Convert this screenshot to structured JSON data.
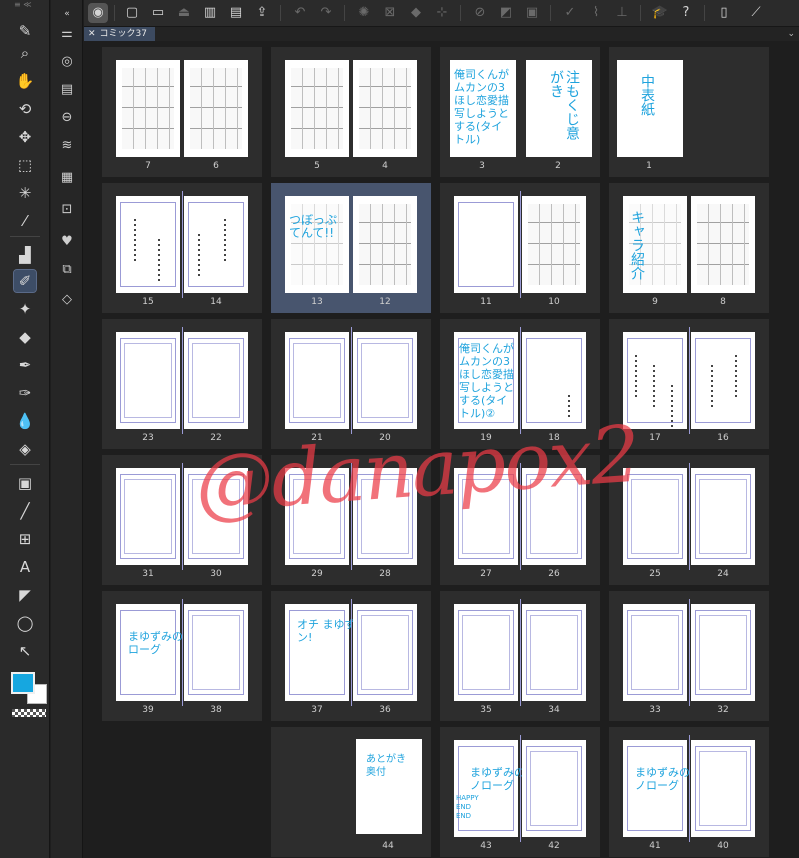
{
  "tab": {
    "title": "コミック37"
  },
  "tools": [
    "menu-icon",
    "zoom-icon",
    "hand-icon",
    "rotate-icon",
    "move-icon",
    "selection-icon",
    "magic-wand-icon",
    "eyedropper-icon",
    "pen-icon",
    "pencil-icon",
    "sparkle-icon",
    "eraser-icon",
    "brush-icon",
    "ink-icon",
    "blend-icon",
    "fill-icon",
    "gradient-icon",
    "line-icon",
    "frame-icon",
    "text-icon",
    "balloon-icon",
    "lasso-icon",
    "operation-icon"
  ],
  "colors": {
    "main": "#16a7e0",
    "sub": "#ffffff",
    "accent": "#48556e"
  },
  "watermark": "@danapox2",
  "pages": {
    "p1": "1",
    "p2": "2",
    "p3": "3",
    "p4": "4",
    "p5": "5",
    "p6": "6",
    "p7": "7",
    "p8": "8",
    "p9": "9",
    "p10": "10",
    "p11": "11",
    "p12": "12",
    "p13": "13",
    "p14": "14",
    "p15": "15",
    "p16": "16",
    "p17": "17",
    "p18": "18",
    "p19": "19",
    "p20": "20",
    "p21": "21",
    "p22": "22",
    "p23": "23",
    "p24": "24",
    "p25": "25",
    "p26": "26",
    "p27": "27",
    "p28": "28",
    "p29": "29",
    "p30": "30",
    "p31": "31",
    "p32": "32",
    "p33": "33",
    "p34": "34",
    "p35": "35",
    "p36": "36",
    "p37": "37",
    "p38": "38",
    "p39": "39",
    "p40": "40",
    "p41": "41",
    "p42": "42",
    "p43": "43",
    "p44": "44"
  },
  "notes": {
    "n3": "俺司くんがムカンの3ほし恋愛描写しようとする(タイトル)",
    "n2": "注もくじ意がき",
    "n1": "中表紙",
    "n13": "つぼっぷてんて!!",
    "n9": "キャラ紹介",
    "n19": "俺司くんがムカンの3ほし恋愛描写しようとする(タイトル)②",
    "n39": "まゆずみのながー モノローグ",
    "n37": "オチ まゆずみの ターーン!",
    "n44": "あとがき 奥付",
    "n43a": "まゆずみの ながー モノローグ",
    "n43b": "HAPPY END END",
    "n41": "まゆずみの ながー モノローグ"
  }
}
